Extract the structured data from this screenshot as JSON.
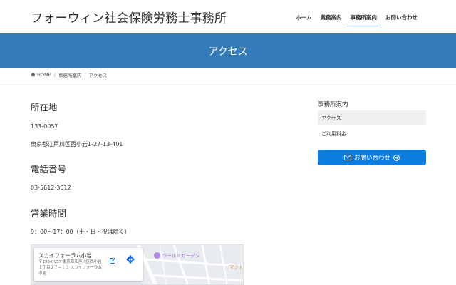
{
  "header": {
    "site_title": "フォーウィン社会保険労務士事務所",
    "nav": [
      {
        "label": "ホーム"
      },
      {
        "label": "業務案内"
      },
      {
        "label": "事務所案内",
        "active": true
      },
      {
        "label": "お問い合わせ"
      }
    ]
  },
  "page_header": {
    "title": "アクセス"
  },
  "breadcrumb": {
    "home": "HOME",
    "items": [
      "事務所案内",
      "アクセス"
    ]
  },
  "main": {
    "location_heading": "所在地",
    "postal_code": "133-0057",
    "address": "東京都江戸川区西小岩1-27-13-401",
    "phone_heading": "電話番号",
    "phone": "03-5612-3012",
    "hours_heading": "営業時間",
    "hours": "9：00〜17：00（土・日・祝は除く）"
  },
  "map": {
    "place_name": "スカイフォーラム小岩",
    "place_address": "〒133-0057 東京都江戸川区西小岩１丁目２７−１３ スカイフォーラム小岩",
    "poi_label": "ワールドガーデン",
    "poi_label2": "マクド",
    "colors": {
      "road": "#ffffff",
      "poi": "#b388e0"
    }
  },
  "sidebar": {
    "title": "事務所案内",
    "items": [
      {
        "label": "アクセス",
        "active": true
      },
      {
        "label": "ご利用料金"
      }
    ],
    "contact_button": "お問い合わせ"
  },
  "colors": {
    "primary": "#337ab7",
    "button": "#0d7de0",
    "text": "#333333"
  }
}
